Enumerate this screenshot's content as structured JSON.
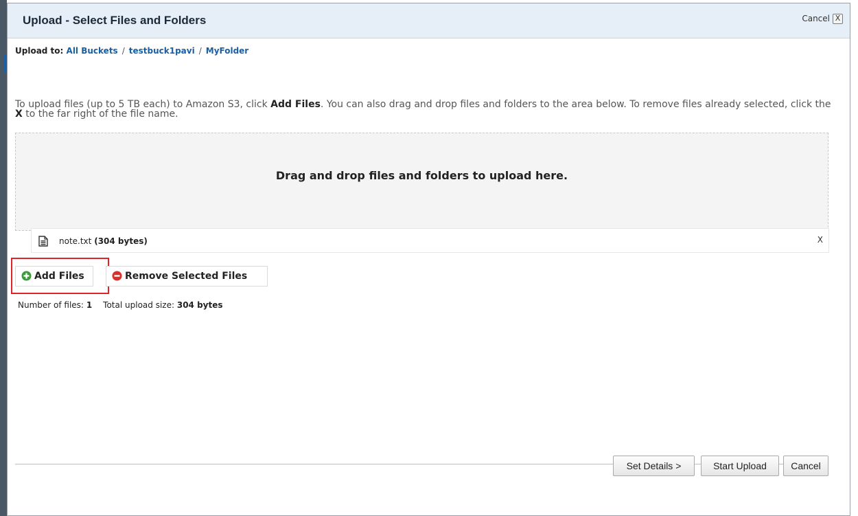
{
  "dialog": {
    "title": "Upload - Select Files and Folders",
    "cancel_label": "Cancel",
    "close_glyph": "X"
  },
  "breadcrumb": {
    "prefix": "Upload to:",
    "items": [
      "All Buckets",
      "testbuck1pavi",
      "MyFolder"
    ],
    "separator": "/"
  },
  "instructions": {
    "part1": "To upload files (up to 5 TB each) to Amazon S3, click ",
    "bold1": "Add Files",
    "part2": ". You can also drag and drop files and folders to the area below. To remove files already selected, click the ",
    "bold2": "X",
    "part3": " to the far right of the file name."
  },
  "dropzone": {
    "text": "Drag and drop files and folders to upload here."
  },
  "files": [
    {
      "name": "note.txt",
      "size": "(304 bytes)",
      "remove": "X",
      "icon": "document-icon"
    }
  ],
  "actions": {
    "add_files": "Add Files",
    "remove_selected": "Remove Selected Files"
  },
  "stats": {
    "count_label": "Number of files:",
    "count_value": "1",
    "size_label": "Total upload size:",
    "size_value": "304 bytes"
  },
  "footer": {
    "set_details": "Set Details >",
    "start_upload": "Start Upload",
    "cancel": "Cancel"
  },
  "colors": {
    "link": "#1b5fa3",
    "titlebar": "#e6eef7",
    "highlight": "#e0222a",
    "add_icon": "#3a9b3a",
    "remove_icon": "#d6312b"
  }
}
